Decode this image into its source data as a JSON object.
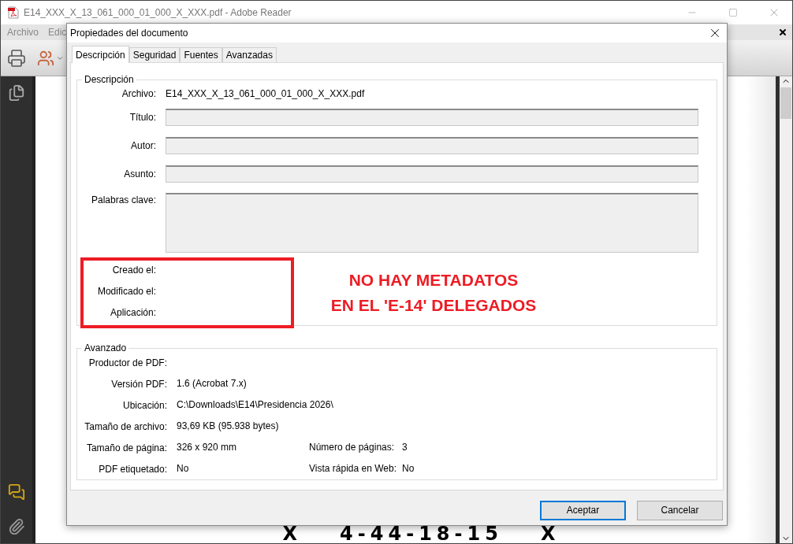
{
  "app": {
    "title": "E14_XXX_X_13_061_000_01_000_X_XXX.pdf - Adobe Reader",
    "menu": [
      {
        "label": "Archivo"
      },
      {
        "label": "Edic"
      }
    ]
  },
  "document_text": [
    "X",
    "4-44-18-15",
    "X"
  ],
  "dialog": {
    "title": "Propiedades del documento",
    "tabs": [
      {
        "label": "Descripción",
        "selected": true
      },
      {
        "label": "Seguridad",
        "selected": false
      },
      {
        "label": "Fuentes",
        "selected": false
      },
      {
        "label": "Avanzadas",
        "selected": false
      }
    ],
    "description": {
      "legend": "Descripción",
      "file": {
        "label": "Archivo:",
        "value": "E14_XXX_X_13_061_000_01_000_X_XXX.pdf"
      },
      "fields": [
        {
          "label": "Título:",
          "kind": "line"
        },
        {
          "label": "Autor:",
          "kind": "line"
        },
        {
          "label": "Asunto:",
          "kind": "line"
        },
        {
          "label": "Palabras clave:",
          "kind": "area"
        }
      ],
      "dates": [
        "Creado el:",
        "Modificado el:",
        "Aplicación:"
      ]
    },
    "advanced": {
      "legend": "Avanzado",
      "rows": [
        {
          "label": "Productor de PDF:"
        },
        {
          "label": "Versión PDF:",
          "value": "1.6 (Acrobat 7.x)"
        },
        {
          "label": "Ubicación:",
          "value": "C:\\Downloads\\E14\\Presidencia 2026\\"
        },
        {
          "label": "Tamaño de archivo:",
          "value": "93,69 KB (95.938 bytes)"
        },
        {
          "label": "Tamaño de página:",
          "value": "326 x 920 mm",
          "label_2": "Número de páginas:",
          "value_2": "3"
        },
        {
          "label": "PDF etiquetado:",
          "value": "No",
          "label_2": "Vista rápida en Web:",
          "value_2": "No"
        }
      ]
    },
    "buttons": [
      {
        "label": "Aceptar",
        "default": true
      },
      {
        "label": "Cancelar",
        "default": false
      }
    ]
  },
  "annotation": {
    "lines": [
      "NO HAY METADATOS",
      "EN EL 'E-14' DELEGADOS"
    ]
  }
}
